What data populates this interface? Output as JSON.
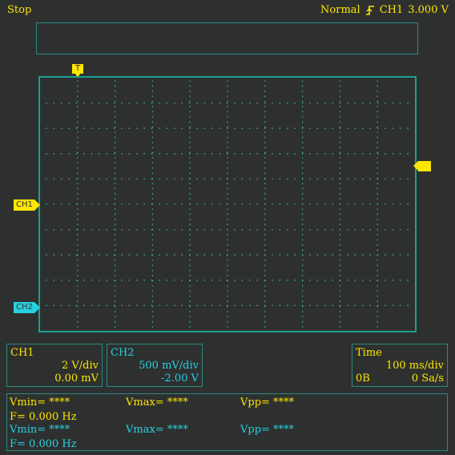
{
  "header": {
    "status": "Stop",
    "trigger_mode": "Normal",
    "trigger_source": "CH1",
    "trigger_level": "3.000 V"
  },
  "markers": {
    "trigger_time": "T",
    "ch1": "CH1",
    "ch2": "CH2"
  },
  "channels": [
    {
      "name": "CH1",
      "scale": "2 V/div",
      "offset": "0.00 mV",
      "color": "#ffe600"
    },
    {
      "name": "CH2",
      "scale": "500 mV/div",
      "offset": "-2.00 V",
      "color": "#27d2e0"
    }
  ],
  "timebase": {
    "label": "Time",
    "scale": "100 ms/div",
    "mode": "0B",
    "rate": "0 Sa/s"
  },
  "measurements": [
    {
      "vmin": "Vmin= ****",
      "vmax": "Vmax= ****",
      "vpp": "Vpp= ****",
      "freq": "F= 0.000 Hz"
    },
    {
      "vmin": "Vmin= ****",
      "vmax": "Vmax= ****",
      "vpp": "Vpp= ****",
      "freq": "F= 0.000 Hz"
    }
  ],
  "colors": {
    "grid": "#1aa090",
    "dots": "#3fbfa8",
    "background": "#2e3030"
  }
}
